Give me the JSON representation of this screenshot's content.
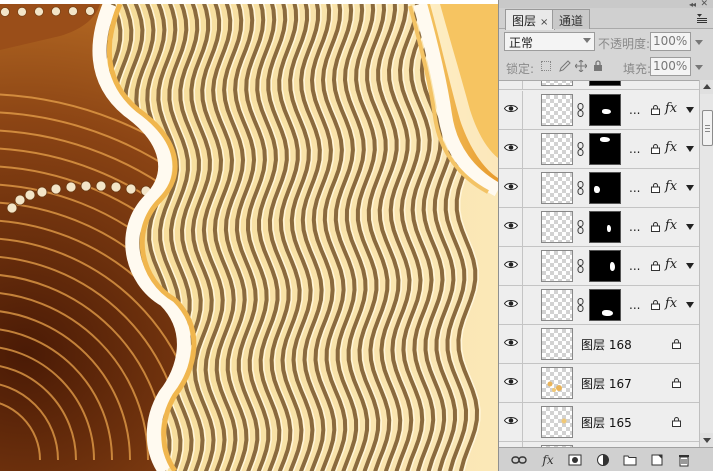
{
  "panel": {
    "tabs": [
      {
        "label": "图层",
        "close": "×"
      },
      {
        "label": "通道"
      }
    ],
    "blend_mode": "正常",
    "opacity_label": "不透明度:",
    "opacity_value": "100%",
    "lock_label": "锁定:",
    "fill_label": "填充:",
    "fill_value": "100%"
  },
  "layers": [
    {
      "type": "masked",
      "ellipsis": "...",
      "fx": "fx"
    },
    {
      "type": "masked",
      "ellipsis": "...",
      "fx": "fx"
    },
    {
      "type": "masked",
      "ellipsis": "...",
      "fx": "fx"
    },
    {
      "type": "masked",
      "ellipsis": "...",
      "fx": "fx"
    },
    {
      "type": "masked",
      "ellipsis": "...",
      "fx": "fx"
    },
    {
      "type": "masked",
      "ellipsis": "...",
      "fx": "fx"
    },
    {
      "type": "plain",
      "name": "图层 168"
    },
    {
      "type": "plain",
      "name": "图层 167"
    },
    {
      "type": "plain",
      "name": "图层 165"
    }
  ],
  "bottom_bar": {
    "icons": [
      "link-icon",
      "fx-icon",
      "mask-icon",
      "adjustment-icon",
      "folder-icon",
      "new-layer-icon",
      "trash-icon"
    ],
    "fx_label": "fx"
  },
  "colors": {
    "panel_bg": "#d6d6d6",
    "list_bg": "#eeeeee",
    "canvas_brown": "#7a3a12",
    "canvas_gold": "#f2c56b"
  }
}
